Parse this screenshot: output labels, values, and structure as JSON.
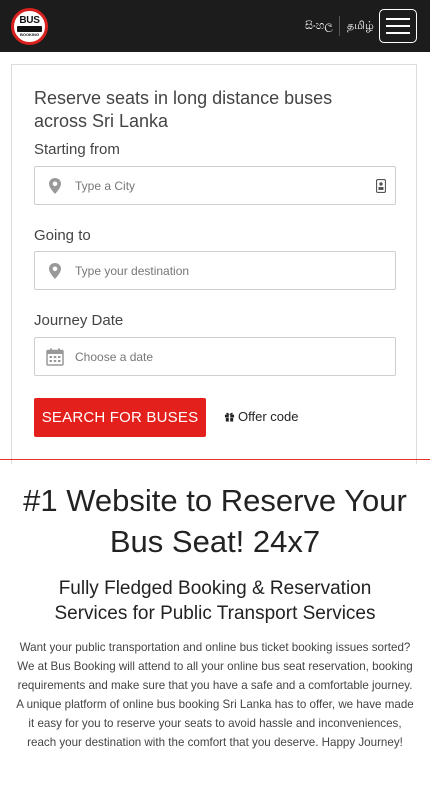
{
  "header": {
    "logo_text": "BUS",
    "logo_subtext": "BOOKING",
    "lang_sinhala": "සිංහල",
    "lang_tamil": "தமிழ்"
  },
  "form": {
    "title": "Reserve seats in long distance buses across Sri Lanka",
    "from_label": "Starting from",
    "from_placeholder": "Type a City",
    "to_label": "Going to",
    "to_placeholder": "Type your destination",
    "date_label": "Journey Date",
    "date_placeholder": "Choose a date",
    "search_button": "SEARCH FOR BUSES",
    "offer_code": "Offer code"
  },
  "content": {
    "headline": "#1 Website to Reserve Your Bus Seat! 24x7",
    "subheadline": "Fully Fledged Booking & Reservation Services for Public Transport Services",
    "paragraph": "Want your public transportation and online bus ticket booking issues sorted? We at Bus Booking will attend to all your online bus seat reservation, booking requirements and make sure that you have a safe and a comfortable journey. A unique platform of online bus booking Sri Lanka has to offer, we have made it easy for you to reserve your seats to avoid hassle and inconveniences, reach your destination with the comfort that you deserve. Happy Journey!"
  },
  "icons": {
    "location": "map-marker-icon",
    "calendar": "calendar-icon",
    "gift": "gift-icon",
    "menu": "hamburger-menu-icon"
  },
  "colors": {
    "brand_red": "#e3201b",
    "nav_bg": "#1c1c1c"
  }
}
